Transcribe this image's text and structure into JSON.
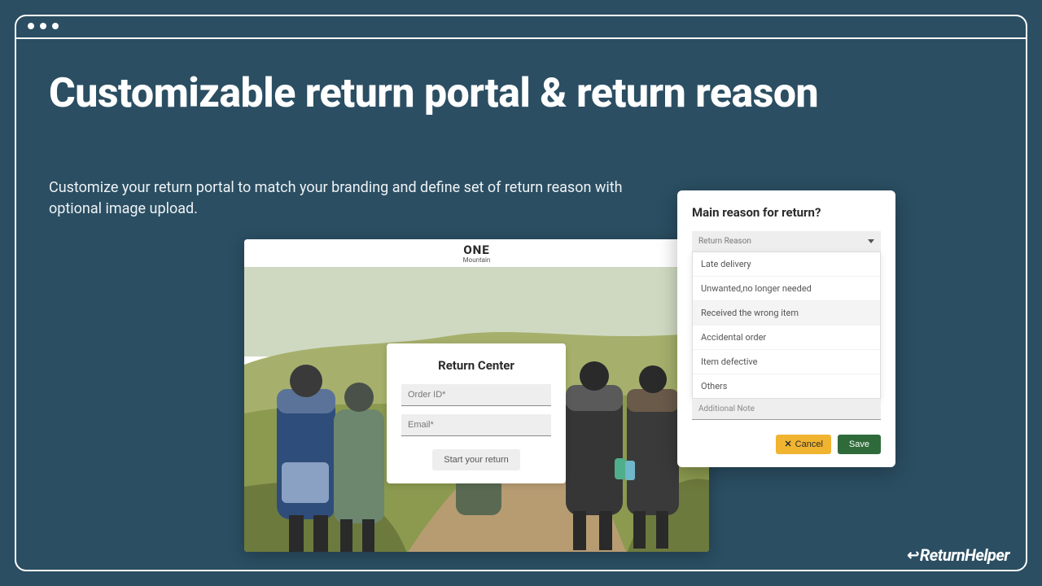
{
  "headline": "Customizable return portal & return reason",
  "subhead": "Customize your return portal to match your branding and define set of return reason with optional image upload.",
  "portal": {
    "brand_name": "ONE",
    "brand_sub": "Mountain",
    "card_title": "Return Center",
    "order_placeholder": "Order ID*",
    "email_placeholder": "Email*",
    "start_label": "Start your return"
  },
  "reason_modal": {
    "title": "Main reason for return?",
    "select_placeholder": "Return Reason",
    "options": [
      "Late delivery",
      "Unwanted,no longer needed",
      "Received the wrong item",
      "Accidental order",
      "Item defective",
      "Others"
    ],
    "highlighted_index": 2,
    "additional_note_placeholder": "Additional Note",
    "cancel_label": "Cancel",
    "save_label": "Save"
  },
  "footer_brand": "ReturnHelper"
}
